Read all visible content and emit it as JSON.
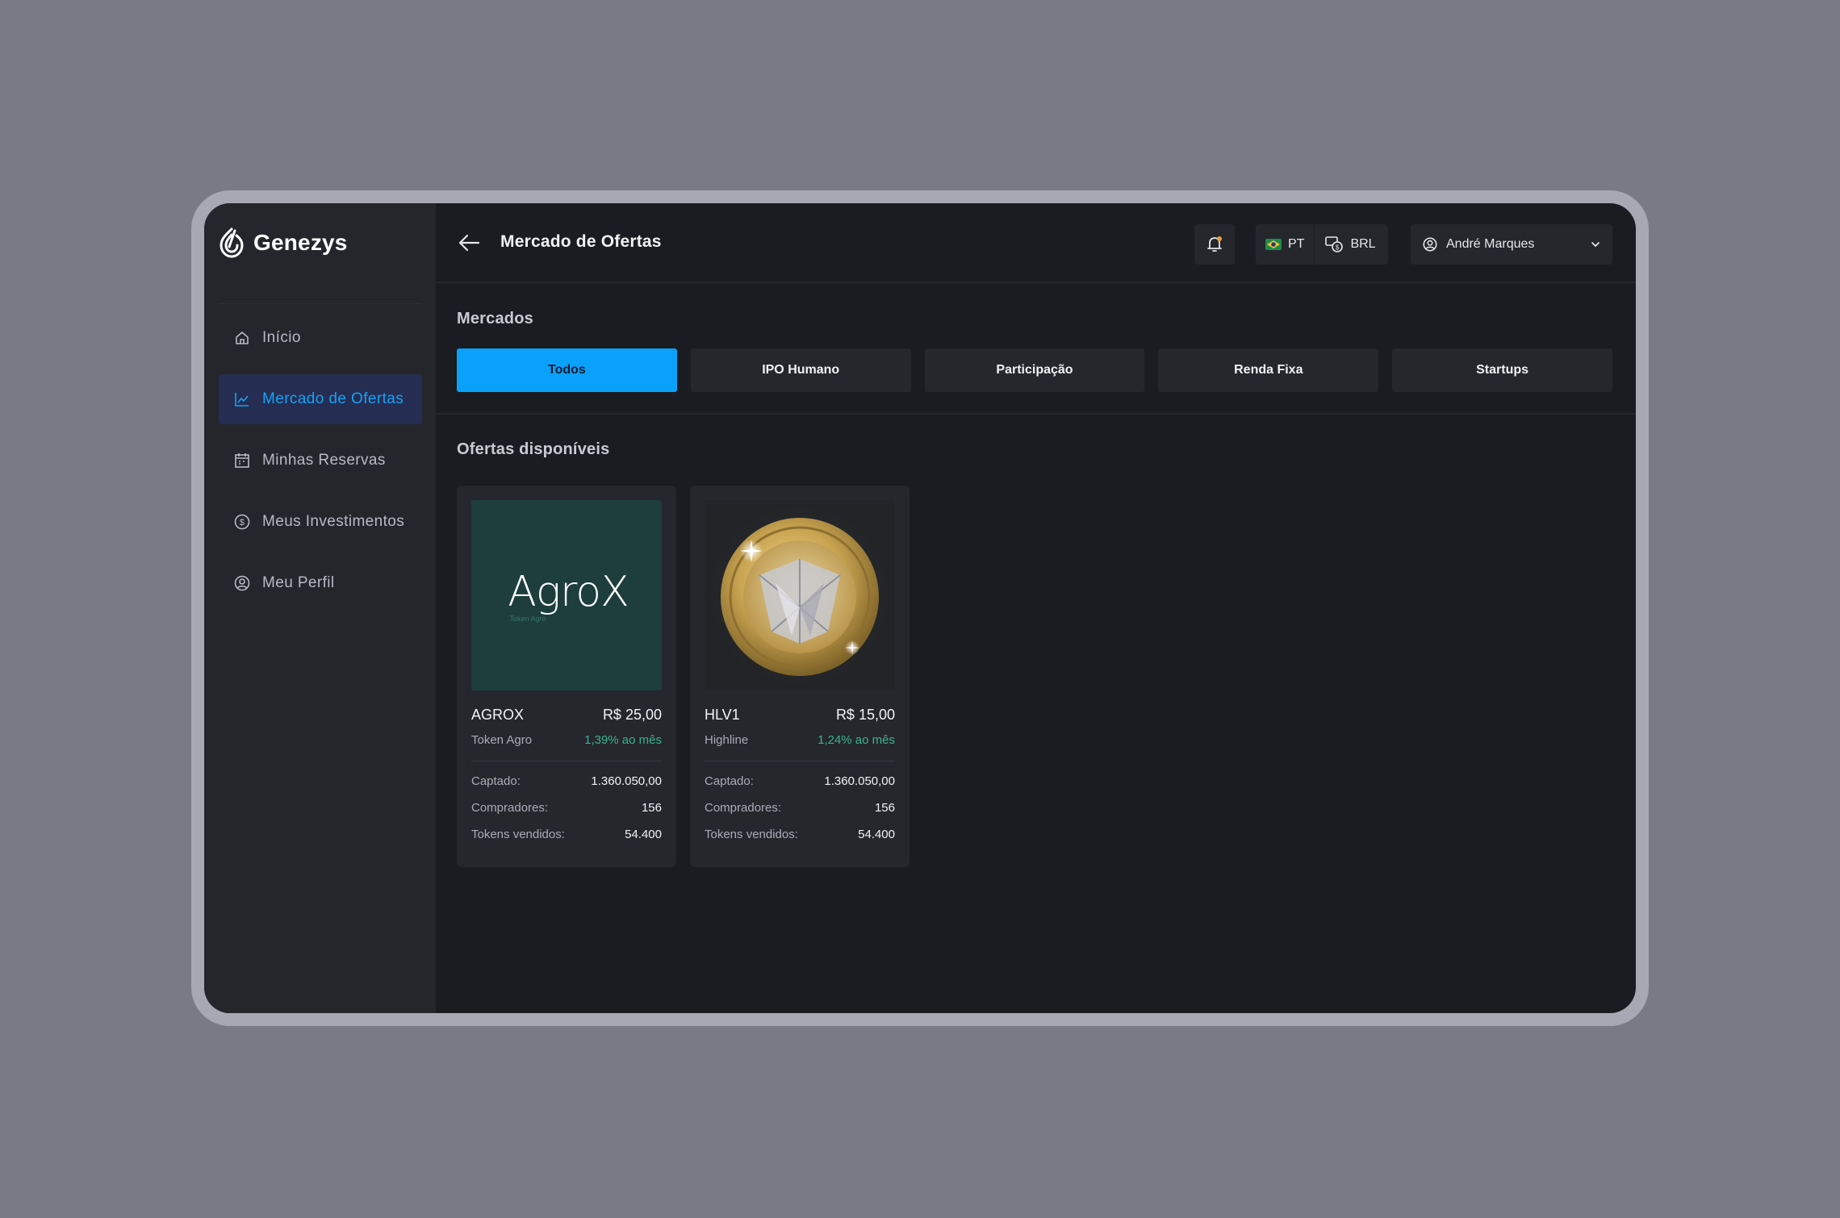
{
  "app": {
    "name": "Genezys"
  },
  "sidebar": {
    "items": [
      {
        "label": "Início",
        "icon": "home-icon",
        "active": false
      },
      {
        "label": "Mercado de Ofertas",
        "icon": "chart-line-icon",
        "active": true
      },
      {
        "label": "Minhas Reservas",
        "icon": "calendar-icon",
        "active": false
      },
      {
        "label": "Meus Investimentos",
        "icon": "dollar-circle-icon",
        "active": false
      },
      {
        "label": "Meu Perfil",
        "icon": "user-circle-icon",
        "active": false
      }
    ]
  },
  "header": {
    "title": "Mercado de Ofertas",
    "language": "PT",
    "currency": "BRL",
    "user_name": "André Marques"
  },
  "markets": {
    "label": "Mercados",
    "tabs": [
      {
        "label": "Todos",
        "active": true
      },
      {
        "label": "IPO Humano",
        "active": false
      },
      {
        "label": "Participação",
        "active": false
      },
      {
        "label": "Renda Fixa",
        "active": false
      },
      {
        "label": "Startups",
        "active": false
      }
    ]
  },
  "offers": {
    "label": "Ofertas disponíveis",
    "cards": [
      {
        "code": "AGROX",
        "price": "R$ 25,00",
        "name": "Token Agro",
        "rate": "1,39% ao mês",
        "logo_text": "AgroX",
        "logo_sub": "Token Agro",
        "captado_label": "Captado:",
        "captado": "1.360.050,00",
        "compradores_label": "Compradores:",
        "compradores": "156",
        "tokens_label": "Tokens vendidos:",
        "tokens": "54.400"
      },
      {
        "code": "HLV1",
        "price": "R$ 15,00",
        "name": "Highline",
        "rate": "1,24% ao mês",
        "captado_label": "Captado:",
        "captado": "1.360.050,00",
        "compradores_label": "Compradores:",
        "compradores": "156",
        "tokens_label": "Tokens vendidos:",
        "tokens": "54.400"
      }
    ]
  },
  "colors": {
    "accent": "#0aa1fb",
    "sidebar_bg": "#24262c",
    "main_bg": "#1b1c21",
    "positive": "#3bb28f"
  }
}
